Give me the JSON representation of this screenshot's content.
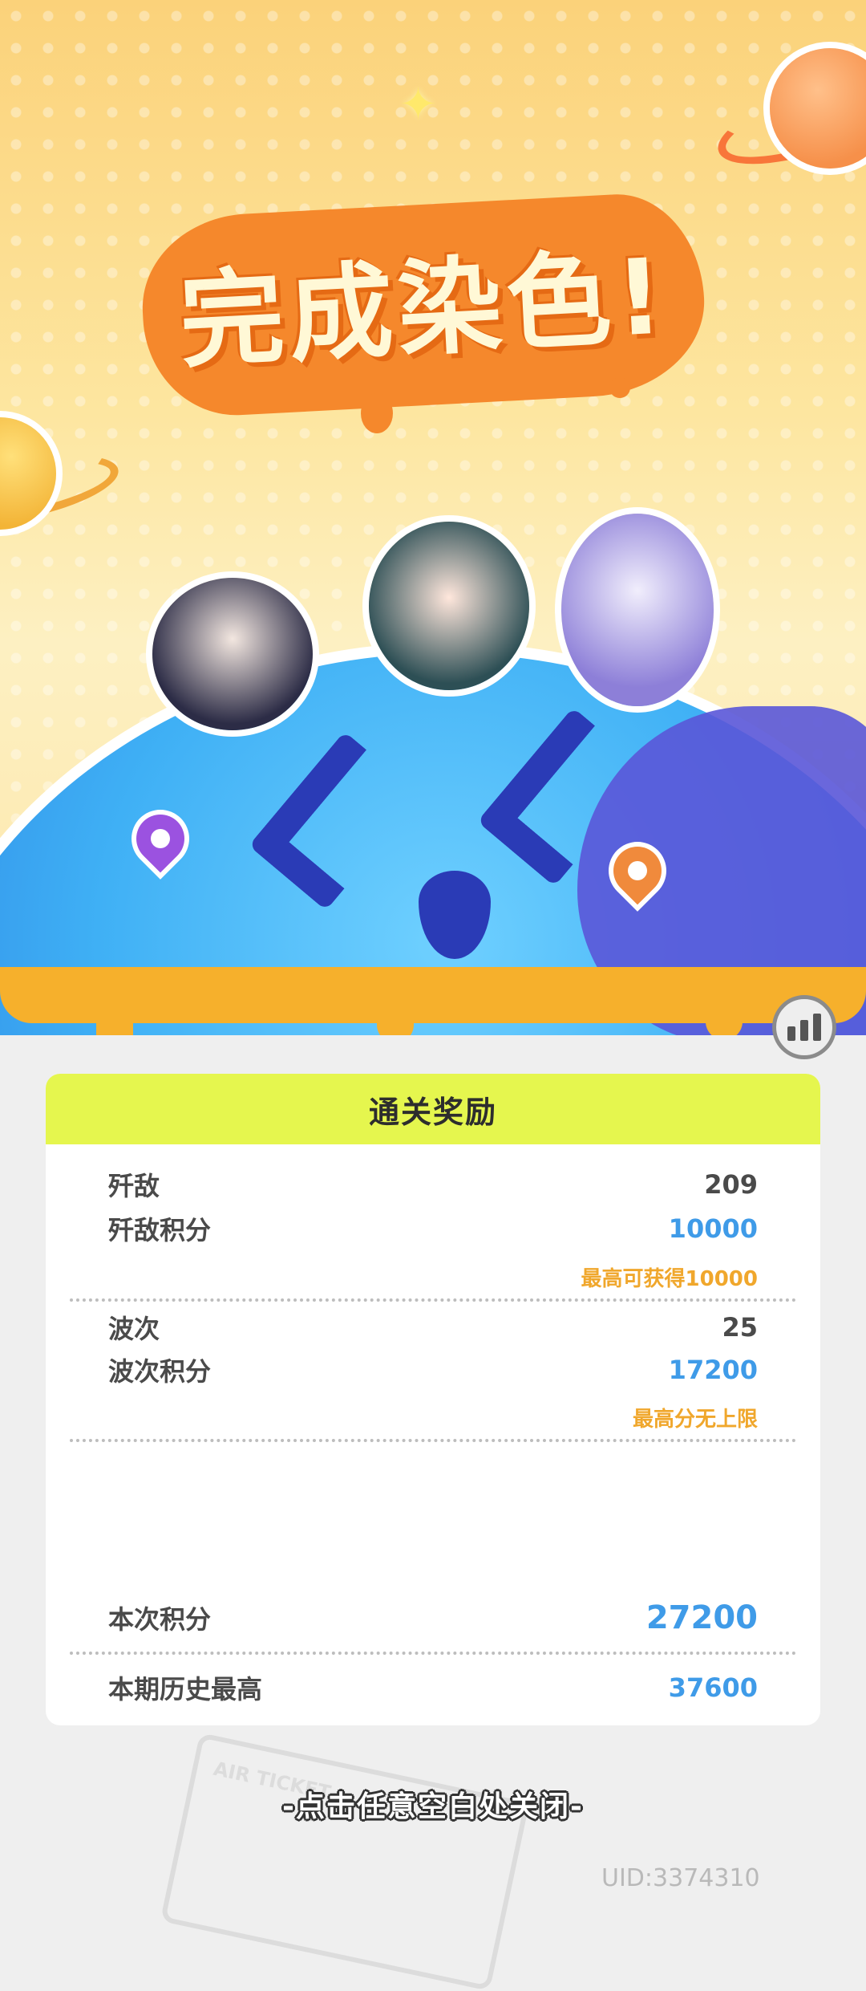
{
  "banner": {
    "title": "完成染色!"
  },
  "reward": {
    "header": "通关奖励",
    "enemies_label": "歼敌",
    "enemies_value": "209",
    "enemy_score_label": "歼敌积分",
    "enemy_score_value": "10000",
    "enemy_score_note": "最高可获得10000",
    "waves_label": "波次",
    "waves_value": "25",
    "wave_score_label": "波次积分",
    "wave_score_value": "17200",
    "wave_score_note": "最高分无上限",
    "total_label": "本次积分",
    "total_value": "27200",
    "best_label": "本期历史最高",
    "best_value": "37600"
  },
  "footer": {
    "close_hint": "-点击任意空白处关闭-",
    "uid": "UID:3374310",
    "ticket_text": "AIR TICKET"
  },
  "icons": {
    "stats": "bar-chart-icon",
    "sparkle": "sparkle-icon",
    "pin": "location-pin-icon"
  },
  "colors": {
    "header_bg": "#e5f64e",
    "accent_blue": "#3f9be8",
    "note_orange": "#f0a72c",
    "splat_orange": "#f5882c"
  }
}
